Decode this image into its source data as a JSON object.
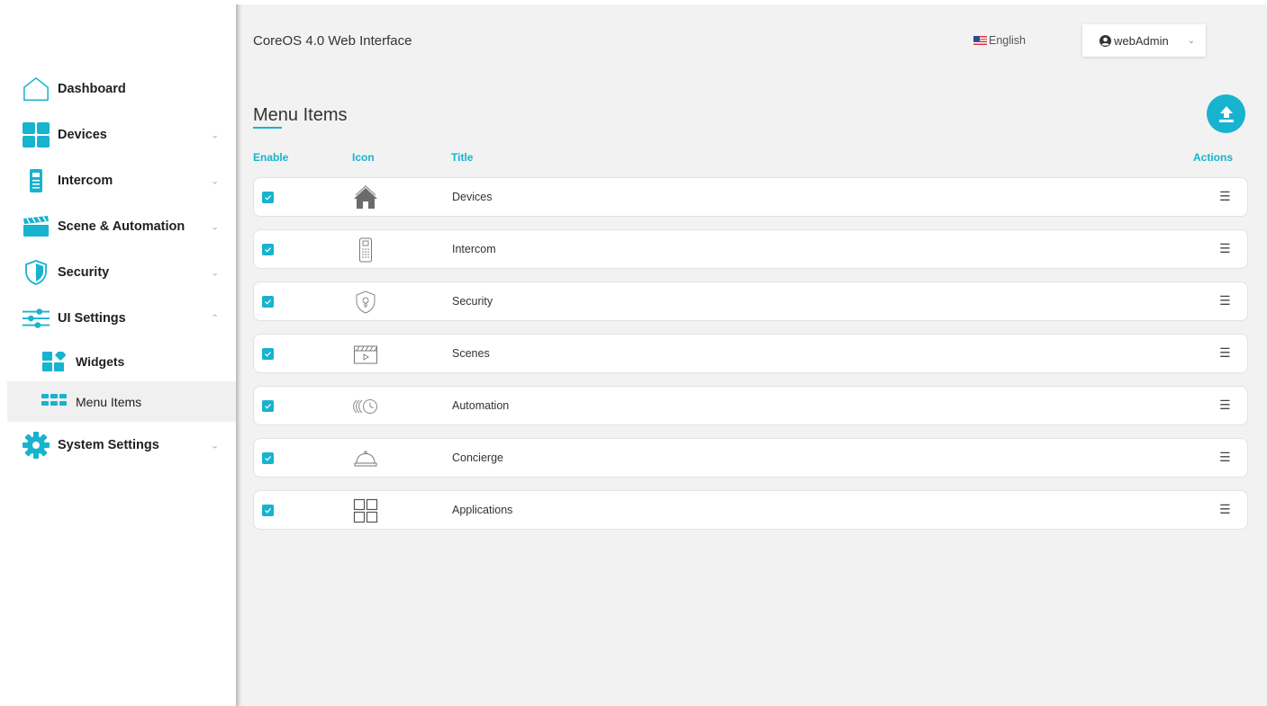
{
  "header": {
    "app_title": "CoreOS 4.0 Web Interface",
    "language": "English",
    "user": "webAdmin"
  },
  "sidebar": {
    "items": [
      {
        "label": "Dashboard",
        "icon": "house-outline-icon",
        "expandable": false
      },
      {
        "label": "Devices",
        "icon": "grid-icon",
        "expandable": true
      },
      {
        "label": "Intercom",
        "icon": "intercom-icon",
        "expandable": true
      },
      {
        "label": "Scene & Automation",
        "icon": "clapperboard-icon",
        "expandable": true
      },
      {
        "label": "Security",
        "icon": "shield-icon",
        "expandable": true
      },
      {
        "label": "UI Settings",
        "icon": "sliders-icon",
        "expandable": true,
        "expanded": true
      },
      {
        "label": "System Settings",
        "icon": "gear-icon",
        "expandable": true
      }
    ],
    "sub_items": [
      {
        "label": "Widgets",
        "icon": "widgets-icon"
      },
      {
        "label": "Menu Items",
        "icon": "menu-grid-icon",
        "active": true
      }
    ]
  },
  "main": {
    "page_title": "Menu Items",
    "columns": {
      "enable": "Enable",
      "icon": "Icon",
      "title": "Title",
      "actions": "Actions"
    },
    "rows": [
      {
        "enabled": true,
        "icon": "house-icon",
        "title": "Devices"
      },
      {
        "enabled": true,
        "icon": "intercom-icon",
        "title": "Intercom"
      },
      {
        "enabled": true,
        "icon": "shield-icon",
        "title": "Security"
      },
      {
        "enabled": true,
        "icon": "clapperboard-icon",
        "title": "Scenes"
      },
      {
        "enabled": true,
        "icon": "automation-clock-icon",
        "title": "Automation"
      },
      {
        "enabled": true,
        "icon": "service-bell-icon",
        "title": "Concierge"
      },
      {
        "enabled": true,
        "icon": "applications-grid-icon",
        "title": "Applications"
      }
    ],
    "actions_glyph": "☰"
  },
  "colors": {
    "accent": "#17b3cf",
    "background": "#f2f2f2",
    "row_background": "#ffffff"
  }
}
